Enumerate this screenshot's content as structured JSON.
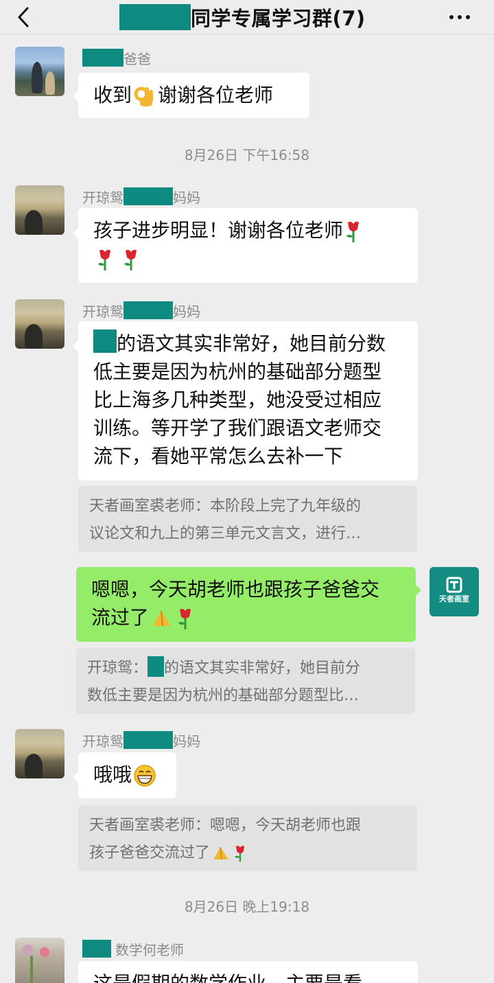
{
  "header": {
    "title": "同学专属学习群(7)"
  },
  "icons": {
    "back": "chevron-left-icon",
    "more": "more-dots-icon"
  },
  "colors": {
    "redaction": "#0f8a80",
    "sent_bubble": "#95ec69",
    "brand_avatar": "#148c82"
  },
  "messages": [
    {
      "sender": "爸爸",
      "text": "收到",
      "text_after_emoji": "谢谢各位老师"
    },
    {
      "time": "8月26日 下午16:58"
    },
    {
      "sender_prefix": "开琼鸳",
      "sender_suffix": "妈妈",
      "text": "孩子进步明显！谢谢各位老师"
    },
    {
      "sender_prefix": "开琼鸳",
      "sender_suffix": "妈妈",
      "lines": [
        "的语文其实非常好，她目前分数",
        "低主要是因为杭州的基础部分题型",
        "比上海多几种类型，她没受过相应",
        "训练。等开学了我们跟语文老师交",
        "流下，看她平常怎么去补一下"
      ],
      "quote_lines": [
        "天者画室裘老师：本阶段上完了九年级的",
        "议论文和九上的第三单元文言文，进行…"
      ]
    },
    {
      "me": true,
      "lines": [
        "嗯嗯，今天胡老师也跟孩子爸爸交",
        "流过了"
      ],
      "quote_prefix": "开琼鸳：",
      "quote_line1_rest": "的语文其实非常好，她目前分",
      "quote_line2": "数低主要是因为杭州的基础部分题型比…",
      "brand_avatar_label": "天者画室"
    },
    {
      "sender_prefix": "开琼鸳",
      "sender_suffix": "妈妈",
      "text": "哦哦",
      "quote_lines": [
        "天者画室裘老师：嗯嗯，今天胡老师也跟",
        "孩子爸爸交流过了"
      ]
    },
    {
      "time": "8月26日 晚上19:18"
    },
    {
      "sender_suffix": "数学何老师",
      "text": "这是假期的数学作业，主要是看"
    }
  ]
}
